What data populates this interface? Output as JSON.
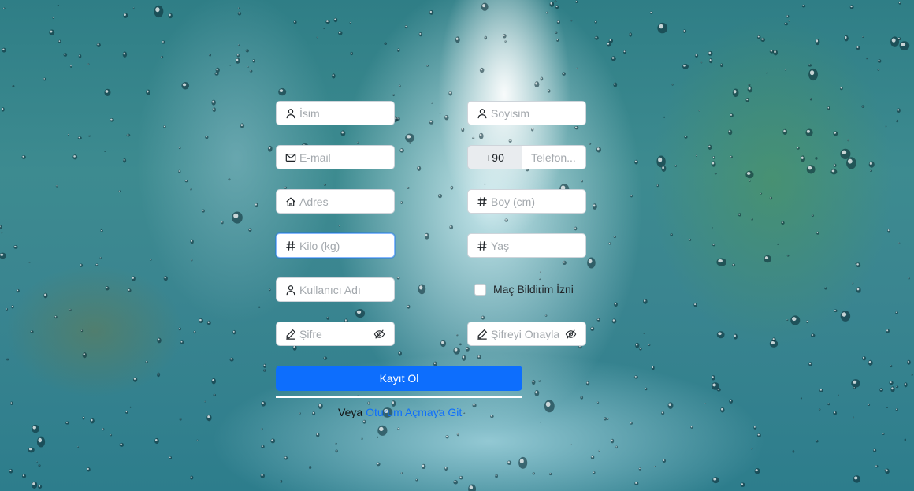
{
  "form": {
    "first_name_placeholder": "İsim",
    "last_name_placeholder": "Soyisim",
    "email_placeholder": "E-mail",
    "phone_prefix": "+90",
    "phone_placeholder": "Telefon...",
    "address_placeholder": "Adres",
    "height_placeholder": "Boy (cm)",
    "weight_placeholder": "Kilo (kg)",
    "age_placeholder": "Yaş",
    "username_placeholder": "Kullanıcı Adı",
    "match_notification_label": "Maç Bildirim İzni",
    "match_notification_checked": false,
    "password_placeholder": "Şifre",
    "confirm_password_placeholder": "Şifreyi Onayla",
    "submit_label": "Kayıt Ol"
  },
  "footer": {
    "prefix": "Veya",
    "login_link": "Oturum Açmaya Git"
  },
  "colors": {
    "primary": "#0d6efd",
    "input_border": "#ced4da",
    "placeholder": "#a3a8ad"
  },
  "icons": {
    "first_name": "user-icon",
    "last_name": "user-icon",
    "email": "envelope-icon",
    "address": "house-icon",
    "height": "hash-icon",
    "weight": "hash-icon",
    "age": "hash-icon",
    "username": "user-icon",
    "password": "pencil-icon",
    "password_toggle": "eye-slash-icon"
  }
}
